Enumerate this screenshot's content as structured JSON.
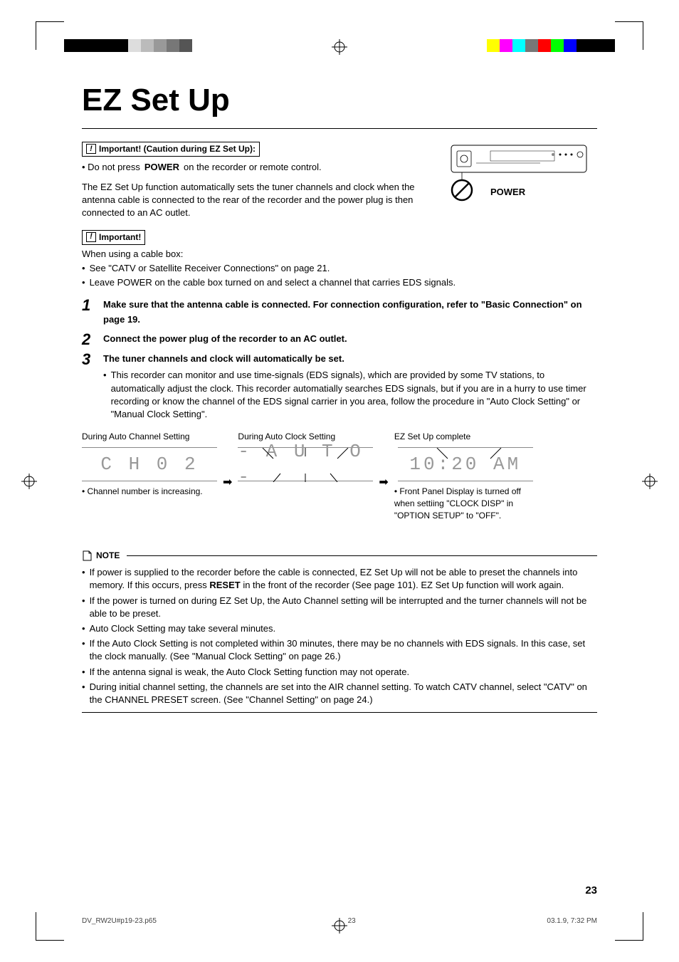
{
  "title": "EZ Set Up",
  "important1": {
    "header": "Important! (Caution during EZ Set Up):",
    "bullet_prefix": "• Do not press ",
    "bullet_bold": "POWER",
    "bullet_suffix": " on the recorder or remote control."
  },
  "device": {
    "label": "POWER"
  },
  "intro_para": "The EZ Set Up function automatically sets the tuner channels and clock when the antenna cable is connected to the rear of the recorder and the power plug is then connected to an AC outlet.",
  "important2": {
    "header": "Important!",
    "line1": "When using a cable box:",
    "bullets": [
      "See \"CATV or Satellite Receiver Connections\" on page 21.",
      "Leave POWER on the cable box turned on and select a channel that carries EDS signals."
    ]
  },
  "steps": {
    "s1": {
      "num": "1",
      "text": "Make sure that the antenna cable is connected. For connection configuration, refer to \"Basic Connection\" on page 19."
    },
    "s2": {
      "num": "2",
      "text": "Connect the power plug of the recorder to an AC outlet."
    },
    "s3": {
      "num": "3",
      "text": "The tuner channels and clock will automatically be set.",
      "sub": "This recorder can monitor and use time-signals (EDS signals), which are provided by some TV stations, to automatically adjust the clock. This recorder automatially searches EDS signals, but if you are in a hurry to use timer recording or know the channel of the EDS signal carrier in you area, follow the procedure in \"Auto Clock Setting\" or \"Manual Clock Setting\"."
    }
  },
  "displays": {
    "col1": {
      "label": "During Auto Channel Setting",
      "lcd": "C H   0 2",
      "caption": "• Channel number is increasing."
    },
    "col2": {
      "label": "During Auto Clock Setting",
      "lcd": "- A U T O -"
    },
    "col3": {
      "label": "EZ Set Up complete",
      "lcd": "10:20 AM",
      "caption": "• Front Panel Display is turned off when settiing \"CLOCK DISP\" in \"OPTION SETUP\" to \"OFF\"."
    }
  },
  "note": {
    "header": "NOTE",
    "items": {
      "n1_part1": "If power is supplied to the recorder before the cable is connected, EZ Set Up will not be able to preset the channels into memory. If this occurs, press ",
      "n1_bold": "RESET",
      "n1_part2": " in the front of the recorder (See page 101). EZ Set Up function will work again.",
      "n2": "If the power is turned on during EZ Set Up, the Auto Channel setting will be interrupted and the turner channels will not be able to be preset.",
      "n3": "Auto Clock Setting may take several minutes.",
      "n4": "If the Auto Clock Setting is not completed within 30 minutes, there may be no channels with EDS signals. In this case, set the clock manually. (See \"Manual Clock Setting\" on page 26.)",
      "n5": "If the antenna signal is weak, the Auto Clock Setting function may not operate.",
      "n6": "During initial channel setting, the channels are set into the AIR channel setting. To watch CATV channel, select \"CATV\" on the CHANNEL PRESET screen. (See \"Channel Setting\" on page 24.)"
    }
  },
  "page_number": "23",
  "footer": {
    "file": "DV_RW2U#p19-23.p65",
    "page": "23",
    "timestamp": "03.1.9, 7:32 PM"
  },
  "color_bars_left": [
    "#000",
    "#000",
    "#000",
    "#000",
    "#000",
    "#ddd",
    "#bbb",
    "#999",
    "#777",
    "#555"
  ],
  "color_bars_right": [
    "#ffff00",
    "#ff00ff",
    "#00ffff",
    "#777",
    "#ff0000",
    "#00ff00",
    "#0000ff",
    "#000",
    "#000",
    "#000"
  ]
}
